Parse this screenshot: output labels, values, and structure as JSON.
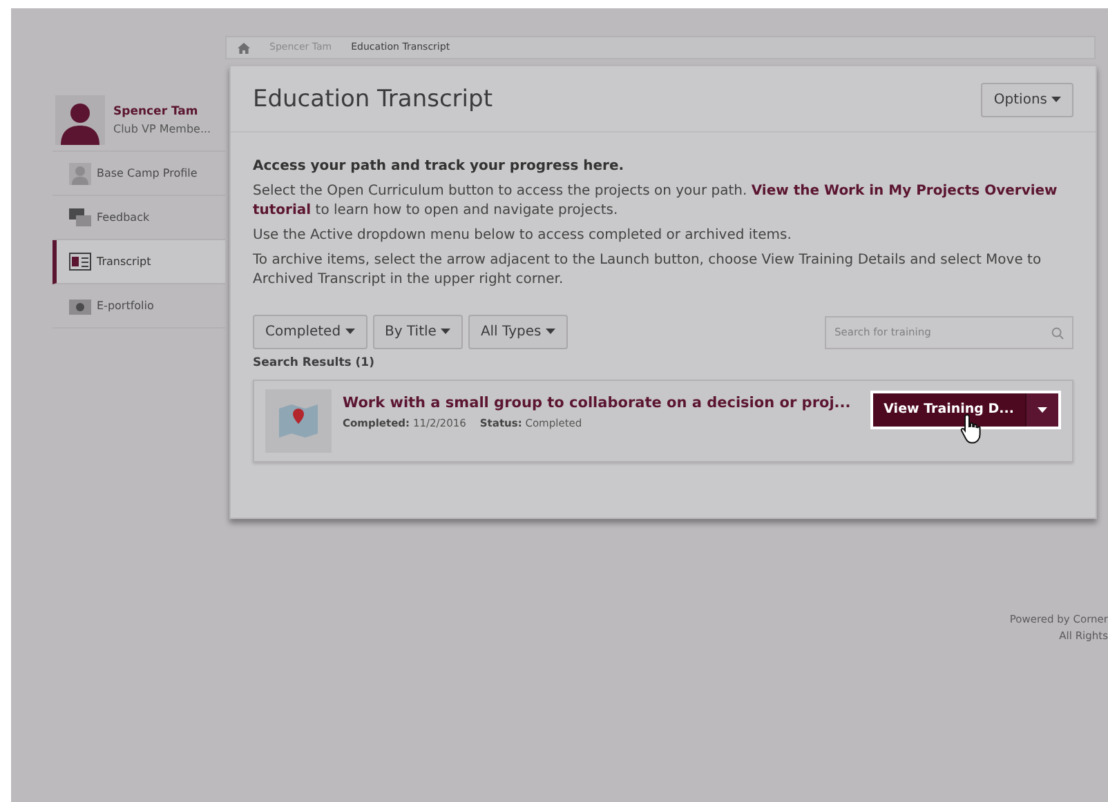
{
  "breadcrumb": [
    {
      "label": "Spencer Tam"
    },
    {
      "label": "Education Transcript"
    }
  ],
  "profile": {
    "name": "Spencer Tam",
    "role": "Club VP Membe..."
  },
  "sidebar": {
    "items": [
      {
        "label": "Base Camp Profile",
        "kind": "person",
        "selected": false
      },
      {
        "label": "Feedback",
        "kind": "chat",
        "selected": false
      },
      {
        "label": "Transcript",
        "kind": "card",
        "selected": true
      },
      {
        "label": "E-portfolio",
        "kind": "camera",
        "selected": false
      }
    ]
  },
  "page_title": "Education Transcript",
  "options_button": "Options",
  "intro": {
    "heading": "Access your path and track your progress here.",
    "paragraphs": [
      "Select the Open Curriculum button to access the projects on your path. **View the Work in My Projects Overview tutorial** to learn how to open and navigate projects.",
      "Use the Active dropdown menu below to access completed or archived items.",
      "To archive items, select the arrow adjacent to the Launch button, choose View Training Details and select Move to Archived Transcript in the upper right corner."
    ]
  },
  "filters": [
    "Completed",
    "By Title",
    "All Types"
  ],
  "search": {
    "placeholder": "Search for training"
  },
  "results_label": "Search Results (1)",
  "results": [
    {
      "title": "Work with a small group to collaborate on a decision or proj...",
      "completed_label": "Completed:",
      "completed_date": "11/2/2016",
      "status_label": "Status:",
      "status": "Completed",
      "action": "View Training D..."
    }
  ],
  "footer": [
    "Powered by Corner",
    "All Rights"
  ]
}
